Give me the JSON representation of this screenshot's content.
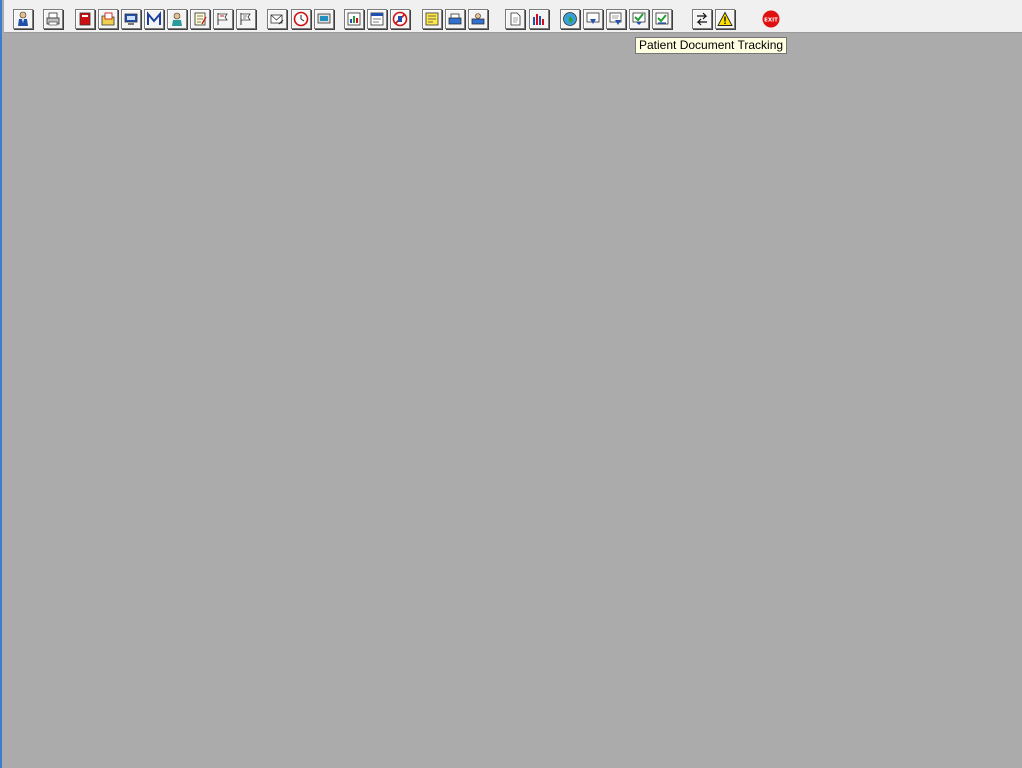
{
  "toolbar": {
    "buttons": [
      {
        "icon": "patient-icon"
      },
      {
        "icon": "printer-icon"
      },
      {
        "icon": "red-book-icon"
      },
      {
        "icon": "open-folder-icon"
      },
      {
        "icon": "monitor-icon"
      },
      {
        "icon": "m-icon"
      },
      {
        "icon": "doctor-icon"
      },
      {
        "icon": "notepad-icon"
      },
      {
        "icon": "flag-icon"
      },
      {
        "icon": "flag-icon"
      },
      {
        "icon": "envelope-icon"
      },
      {
        "icon": "clock-icon"
      },
      {
        "icon": "screen-icon"
      },
      {
        "icon": "chart-window-icon"
      },
      {
        "icon": "form-window-icon"
      },
      {
        "icon": "no-entry-icon"
      },
      {
        "icon": "sticky-note-icon"
      },
      {
        "icon": "fax-icon"
      },
      {
        "icon": "scanner-icon"
      },
      {
        "icon": "document-icon"
      },
      {
        "icon": "bar-chart-icon"
      },
      {
        "icon": "globe-icon"
      },
      {
        "icon": "document-down-arrow-icon"
      },
      {
        "icon": "document-tracking-icon"
      },
      {
        "icon": "document-green-icon"
      },
      {
        "icon": "document-green-check-icon"
      },
      {
        "icon": "transfer-arrows-icon"
      },
      {
        "icon": "warning-icon"
      },
      {
        "icon": "exit-icon"
      }
    ],
    "exit_label": "EXIT"
  },
  "tooltip": {
    "text": "Patient Document Tracking"
  },
  "colors": {
    "mdi_background": "#ababab",
    "toolbar": "#f0f0f0",
    "tooltip_background": "#ffffe1",
    "window_border": "#3d7bd0"
  }
}
